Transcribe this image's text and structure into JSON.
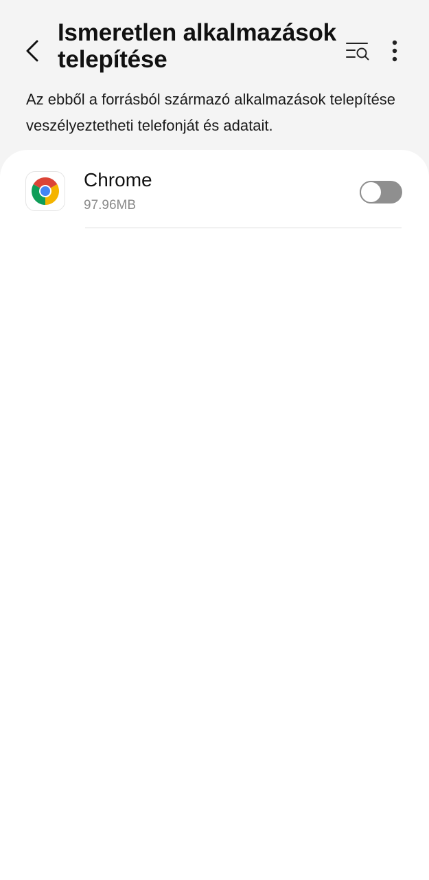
{
  "header": {
    "back_icon": "chevron-left-icon",
    "title": "Ismeretlen alkalmazások telepítése",
    "search_icon": "list-search-icon",
    "more_icon": "more-vertical-icon"
  },
  "description": "Az ebből a forrásból származó alkalmazások telepítése veszélyeztetheti telefonját és adatait.",
  "apps": [
    {
      "name": "Chrome",
      "size": "97.96MB",
      "icon": "chrome-icon",
      "allowed": false
    }
  ],
  "colors": {
    "background": "#f4f4f4",
    "card": "#ffffff",
    "toggle_off": "#8f8f8f",
    "secondary_text": "#8a8a8a"
  }
}
